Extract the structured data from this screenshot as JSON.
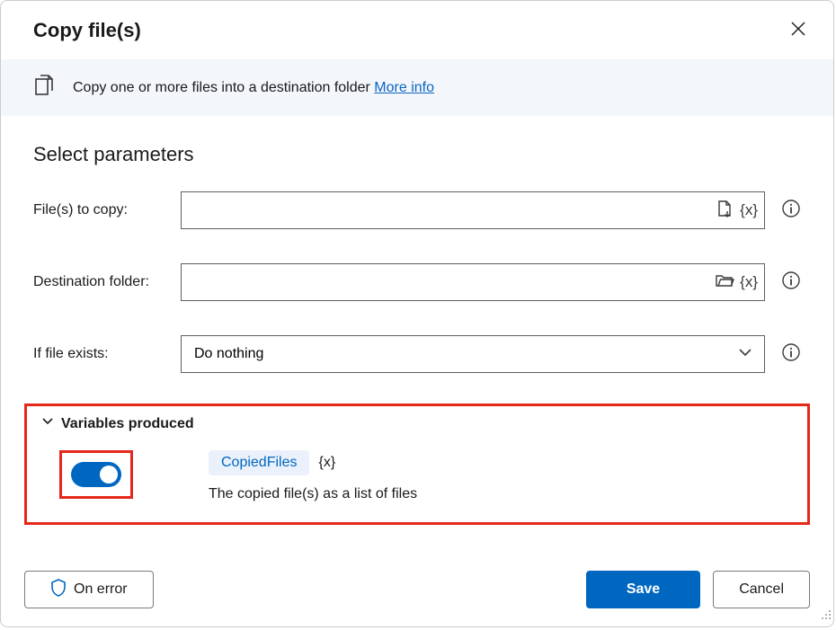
{
  "header": {
    "title": "Copy file(s)"
  },
  "banner": {
    "text": "Copy one or more files into a destination folder ",
    "more_info": "More info"
  },
  "section_title": "Select parameters",
  "fields": {
    "files_to_copy": {
      "label": "File(s) to copy:",
      "value": ""
    },
    "destination": {
      "label": "Destination folder:",
      "value": ""
    },
    "if_exists": {
      "label": "If file exists:",
      "value": "Do nothing"
    }
  },
  "variables": {
    "header": "Variables produced",
    "name": "CopiedFiles",
    "brace": "{x}",
    "description": "The copied file(s) as a list of files"
  },
  "footer": {
    "on_error": "On error",
    "save": "Save",
    "cancel": "Cancel"
  }
}
